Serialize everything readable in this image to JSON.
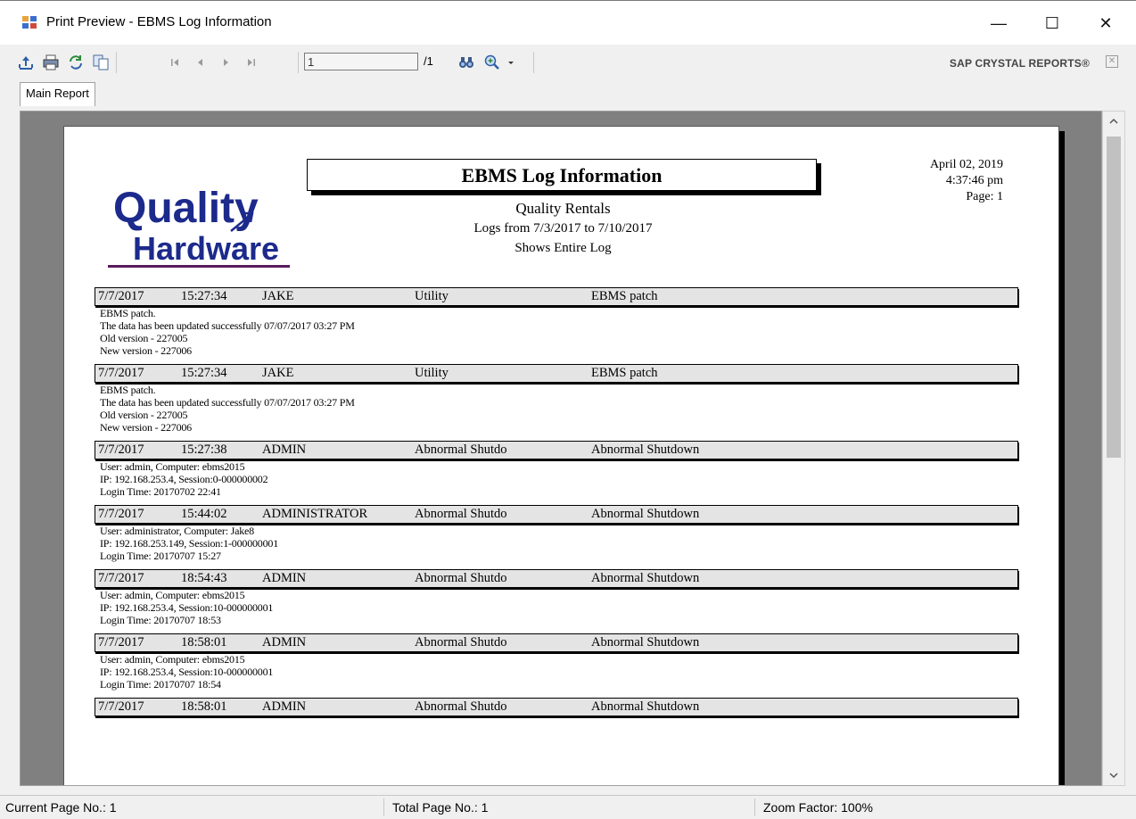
{
  "window": {
    "title": "Print Preview - EBMS Log Information",
    "controls": {
      "minimize": "—",
      "maximize": "☐",
      "close": "✕"
    }
  },
  "toolbar": {
    "page_input_value": "1",
    "page_total": "/1",
    "brand": "SAP CRYSTAL REPORTS®",
    "icons": [
      "export-icon",
      "print-icon",
      "refresh-icon",
      "copy-icon",
      "first-page-icon",
      "prev-page-icon",
      "next-page-icon",
      "last-page-icon",
      "find-icon",
      "zoom-icon",
      "zoom-dropdown-icon",
      "close-brand-icon"
    ]
  },
  "tabs": [
    {
      "label": "Main Report"
    }
  ],
  "report": {
    "logo": {
      "line1": "Quality",
      "line2": "Hardware",
      "colors": {
        "primary": "#1c2a8c",
        "underline": "#5a1a5a"
      }
    },
    "title": "EBMS Log Information",
    "company": "Quality Rentals",
    "range": "Logs from 7/3/2017 to 7/10/2017",
    "scope": "Shows Entire Log",
    "date": "April 02, 2019",
    "time": "4:37:46 pm",
    "page": "Page: 1",
    "entries": [
      {
        "date": "7/7/2017",
        "time": "15:27:34",
        "user": "JAKE",
        "module": "Utility",
        "event": "EBMS patch",
        "details": [
          "EBMS patch.",
          "The data has been updated successfully 07/07/2017 03:27 PM",
          "Old version - 227005",
          "New version - 227006"
        ]
      },
      {
        "date": "7/7/2017",
        "time": "15:27:34",
        "user": "JAKE",
        "module": "Utility",
        "event": "EBMS patch",
        "details": [
          "EBMS patch.",
          "The data has been updated successfully 07/07/2017 03:27 PM",
          "Old version - 227005",
          "New version - 227006"
        ]
      },
      {
        "date": "7/7/2017",
        "time": "15:27:38",
        "user": "ADMIN",
        "module": "Abnormal Shutdo",
        "event": "Abnormal Shutdown",
        "details": [
          "User: admin, Computer: ebms2015",
          "IP: 192.168.253.4, Session:0-000000002",
          "Login Time: 20170702 22:41"
        ]
      },
      {
        "date": "7/7/2017",
        "time": "15:44:02",
        "user": "ADMINISTRATOR",
        "module": "Abnormal Shutdo",
        "event": "Abnormal Shutdown",
        "details": [
          "User: administrator, Computer: Jake8",
          "IP: 192.168.253.149, Session:1-000000001",
          "Login Time: 20170707 15:27"
        ]
      },
      {
        "date": "7/7/2017",
        "time": "18:54:43",
        "user": "ADMIN",
        "module": "Abnormal Shutdo",
        "event": "Abnormal Shutdown",
        "details": [
          "User: admin, Computer: ebms2015",
          "IP: 192.168.253.4, Session:10-000000001",
          "Login Time: 20170707 18:53"
        ]
      },
      {
        "date": "7/7/2017",
        "time": "18:58:01",
        "user": "ADMIN",
        "module": "Abnormal Shutdo",
        "event": "Abnormal Shutdown",
        "details": [
          "User: admin, Computer: ebms2015",
          "IP: 192.168.253.4, Session:10-000000001",
          "Login Time: 20170707 18:54"
        ]
      },
      {
        "date": "7/7/2017",
        "time": "18:58:01",
        "user": "ADMIN",
        "module": "Abnormal Shutdo",
        "event": "Abnormal Shutdown",
        "details": []
      }
    ]
  },
  "statusbar": {
    "current_page": "Current Page No.: 1",
    "total_page": "Total Page No.: 1",
    "zoom": "Zoom Factor: 100%"
  }
}
